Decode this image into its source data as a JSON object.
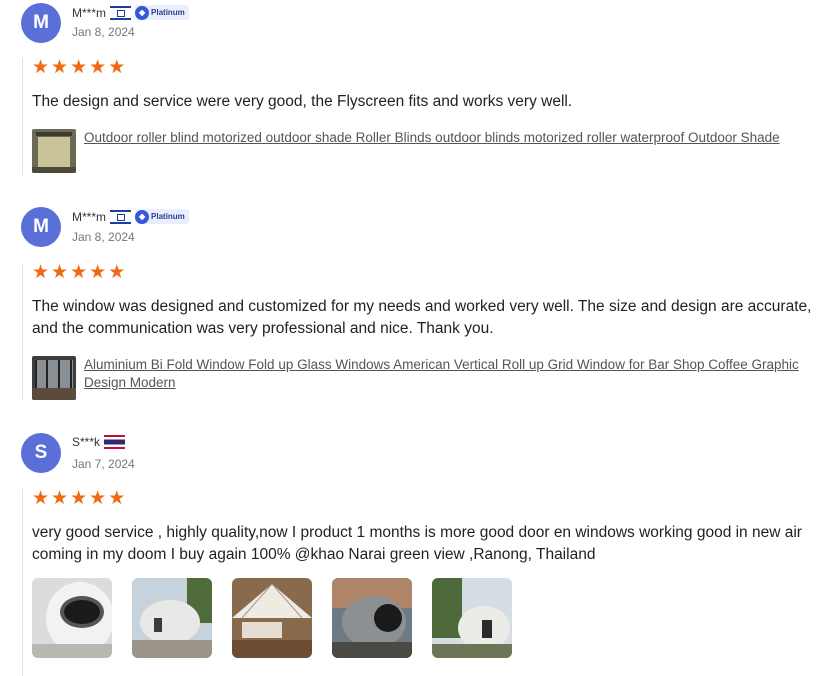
{
  "reviews": [
    {
      "initial": "M",
      "name": "M***m",
      "country_flag": "flag-israel",
      "badge": "Platinum",
      "date": "Jan 8, 2024",
      "rating": 5,
      "text": "The design and service were very good, the Flyscreen fits and works very well.",
      "product": "Outdoor roller blind motorized outdoor shade Roller Blinds outdoor blinds motorized roller waterproof Outdoor Shade"
    },
    {
      "initial": "M",
      "name": "M***m",
      "country_flag": "flag-israel",
      "badge": "Platinum",
      "date": "Jan 8, 2024",
      "rating": 5,
      "text": "The window was designed and customized for my needs and worked very well. The size and design are accurate, and the communication was very professional and nice. Thank you.",
      "product": "Aluminium Bi Fold Window Fold up Glass Windows American Vertical Roll up Grid Window for Bar Shop Coffee Graphic Design Modern"
    },
    {
      "initial": "S",
      "name": "S***k",
      "country_flag": "flag-thailand",
      "date": "Jan 7, 2024",
      "rating": 5,
      "text": "very good service , highly quality,now I product 1 months is more good door en windows working good in new air coming in my doom I buy again 100% @khao Narai green view ,Ranong, Thailand",
      "photo_count": 5
    }
  ],
  "colors": {
    "avatar": "#5a6fd8",
    "star": "#f06a13",
    "badge_bg": "#e8eefc"
  }
}
